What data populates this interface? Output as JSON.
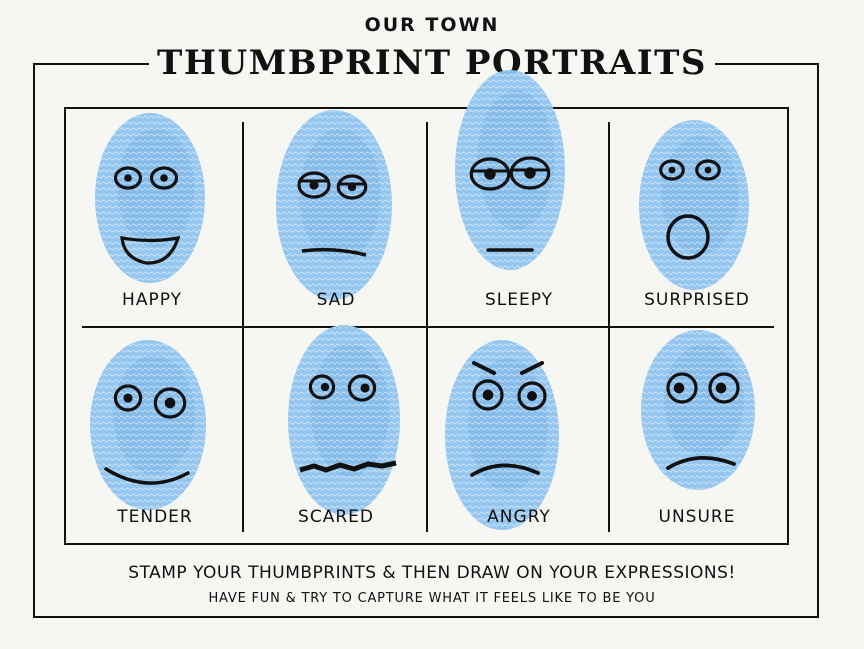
{
  "header": {
    "subtitle": "OUR TOWN",
    "title": "THUMBPRINT PORTRAITS"
  },
  "portraits": [
    {
      "label": "HAPPY",
      "expression": "happy"
    },
    {
      "label": "SAD",
      "expression": "sad"
    },
    {
      "label": "SLEEPY",
      "expression": "sleepy"
    },
    {
      "label": "SURPRISED",
      "expression": "surprised"
    },
    {
      "label": "TENDER",
      "expression": "tender"
    },
    {
      "label": "SCARED",
      "expression": "scared"
    },
    {
      "label": "ANGRY",
      "expression": "angry"
    },
    {
      "label": "UNSURE",
      "expression": "unsure"
    }
  ],
  "footer": {
    "instruction": "STAMP YOUR THUMBPRINTS & THEN DRAW ON YOUR EXPRESSIONS!",
    "note": "HAVE FUN & TRY TO CAPTURE  WHAT IT FEELS LIKE TO BE YOU"
  },
  "colors": {
    "ink_blue": "#8ec3ee",
    "ink_blue_dark": "#6aa9e3",
    "line": "#111111",
    "paper": "#f6f6f3"
  }
}
